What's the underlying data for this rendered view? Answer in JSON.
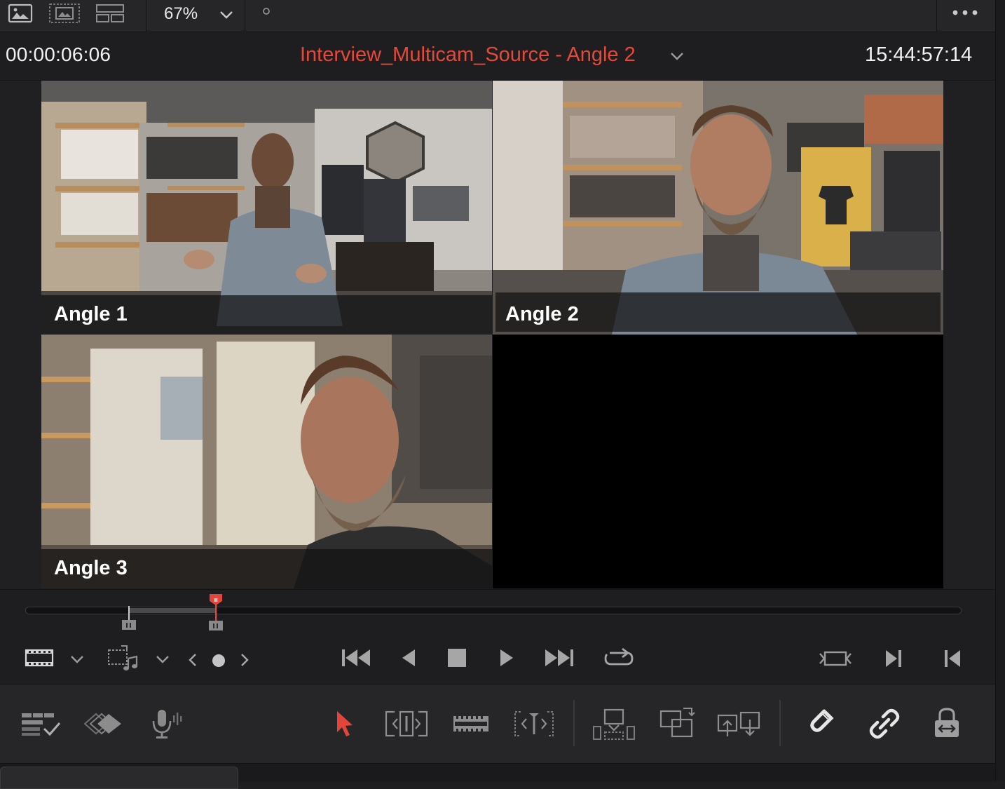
{
  "toolbar": {
    "zoom_value": "67%",
    "icons": [
      "single-viewer-icon",
      "dual-viewer-icon",
      "multicam-grid-icon",
      "zoom-dropdown-icon",
      "dot-icon",
      "more-options-icon"
    ]
  },
  "header": {
    "source_timecode": "00:00:06:06",
    "clip_title": "Interview_Multicam_Source - Angle 2",
    "record_timecode": "15:44:57:14"
  },
  "viewer": {
    "angles": [
      {
        "label": "Angle 1",
        "active": false
      },
      {
        "label": "Angle 2",
        "active": true
      },
      {
        "label": "Angle 3",
        "active": false
      }
    ]
  },
  "colors": {
    "accent_red": "#e2453a",
    "background": "#1e1e20",
    "toolbar": "#262628",
    "icon_gray": "#9a9a9c"
  },
  "transport": {
    "icons": [
      "clip-view-icon",
      "clip-view-dropdown-icon",
      "audio-video-mode-icon",
      "mode-dropdown-icon",
      "prev-angle-icon",
      "angle-dot-icon",
      "next-angle-icon",
      "go-to-start-icon",
      "play-reverse-icon",
      "stop-icon",
      "play-icon",
      "go-to-end-icon",
      "loop-icon",
      "match-frame-icon",
      "next-edit-icon",
      "prev-edit-icon"
    ]
  },
  "edit_tools": {
    "icons": [
      "timeline-options-icon",
      "smart-insert-icon",
      "voiceover-mic-icon",
      "selection-pointer-icon",
      "trim-tool-icon",
      "blade-tool-icon",
      "dynamic-trim-icon",
      "insert-clip-icon",
      "overwrite-clip-icon",
      "replace-clip-icon",
      "snapping-magnet-icon",
      "linked-selection-icon",
      "position-lock-icon"
    ]
  }
}
